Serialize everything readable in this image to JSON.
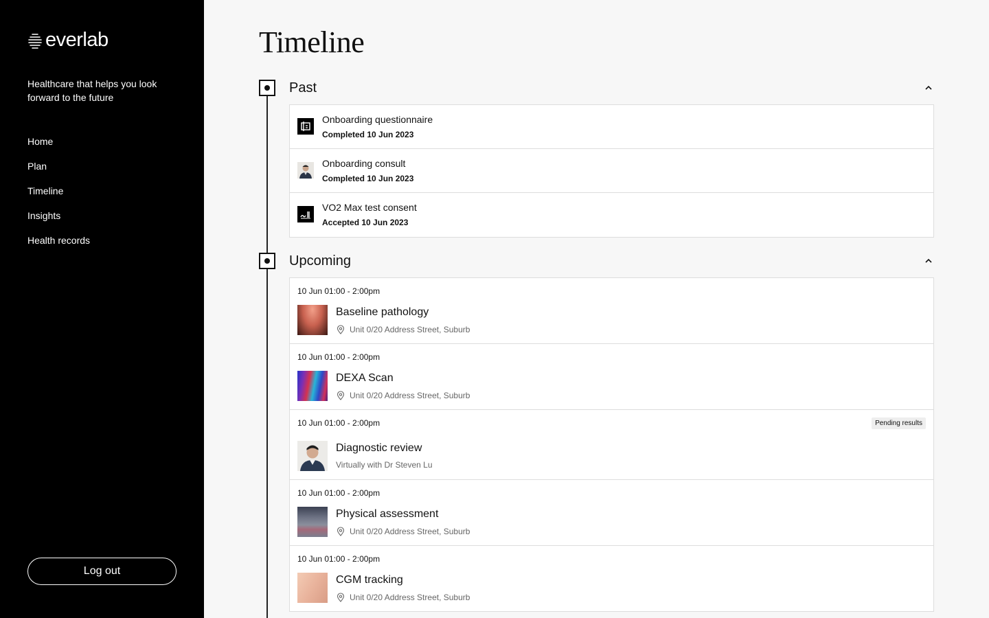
{
  "brand": {
    "name": "everlab",
    "tagline": "Healthcare that helps you look forward to the future"
  },
  "nav": [
    {
      "label": "Home"
    },
    {
      "label": "Plan"
    },
    {
      "label": "Timeline"
    },
    {
      "label": "Insights"
    },
    {
      "label": "Health records"
    }
  ],
  "logout_label": "Log out",
  "page_title": "Timeline",
  "past": {
    "title": "Past",
    "items": [
      {
        "title": "Onboarding questionnaire",
        "status": "Completed 10 Jun 2023",
        "icon": "questionnaire-icon"
      },
      {
        "title": "Onboarding consult",
        "status": "Completed 10 Jun 2023",
        "icon": "doctor-avatar"
      },
      {
        "title": "VO2 Max test consent",
        "status": "Accepted 10 Jun 2023",
        "icon": "signature-icon"
      }
    ]
  },
  "upcoming": {
    "title": "Upcoming",
    "items": [
      {
        "time": "10 Jun 01:00 - 2:00pm",
        "title": "Baseline pathology",
        "location": "Unit 0/20 Address Street, Suburb",
        "thumb": "pathology-thumb"
      },
      {
        "time": "10 Jun 01:00 - 2:00pm",
        "title": "DEXA Scan",
        "location": "Unit 0/20 Address Street, Suburb",
        "thumb": "dexa-thumb"
      },
      {
        "time": "10 Jun 01:00 - 2:00pm",
        "title": "Diagnostic review",
        "location": "Virtually with Dr Steven Lu",
        "badge": "Pending results",
        "thumb": "doctor-thumb"
      },
      {
        "time": "10 Jun 01:00 - 2:00pm",
        "title": "Physical assessment",
        "location": "Unit 0/20 Address Street, Suburb",
        "thumb": "physical-thumb"
      },
      {
        "time": "10 Jun 01:00 - 2:00pm",
        "title": "CGM tracking",
        "location": "Unit 0/20 Address Street, Suburb",
        "thumb": "cgm-thumb"
      }
    ]
  },
  "colors": {
    "sidebar_bg": "#000000",
    "page_bg": "#f7f7f7",
    "card_border": "#dddddd",
    "badge_bg": "#eeeeee"
  }
}
